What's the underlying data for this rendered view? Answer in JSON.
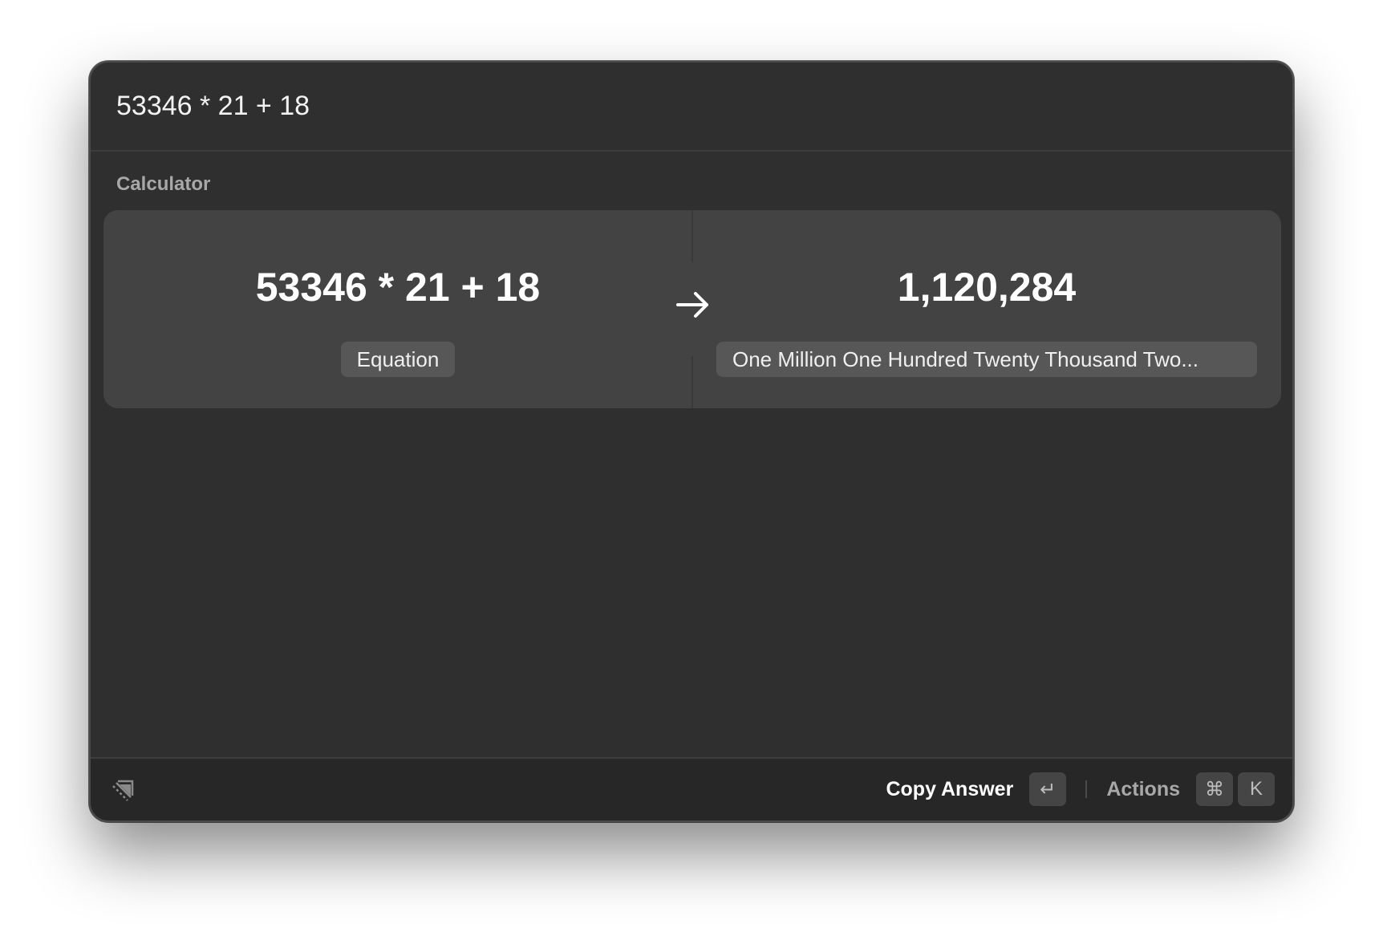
{
  "search": {
    "value": "53346 * 21 + 18"
  },
  "section": {
    "title": "Calculator"
  },
  "calculator": {
    "expression": "53346 * 21 + 18",
    "expression_label": "Equation",
    "result": "1,120,284",
    "result_words": "One Million One Hundred Twenty Thousand Two..."
  },
  "footer": {
    "primary_action": "Copy Answer",
    "primary_key": "↵",
    "secondary_action": "Actions",
    "secondary_keys": [
      "⌘",
      "K"
    ]
  },
  "icons": {
    "logo": "raycast-logo-icon",
    "arrow": "arrow-right-icon"
  },
  "colors": {
    "window_bg": "#2f2f2f",
    "card_bg": "#434343",
    "footer_bg": "#272727",
    "text_primary": "#ffffff",
    "text_secondary": "#a8a8a8"
  }
}
